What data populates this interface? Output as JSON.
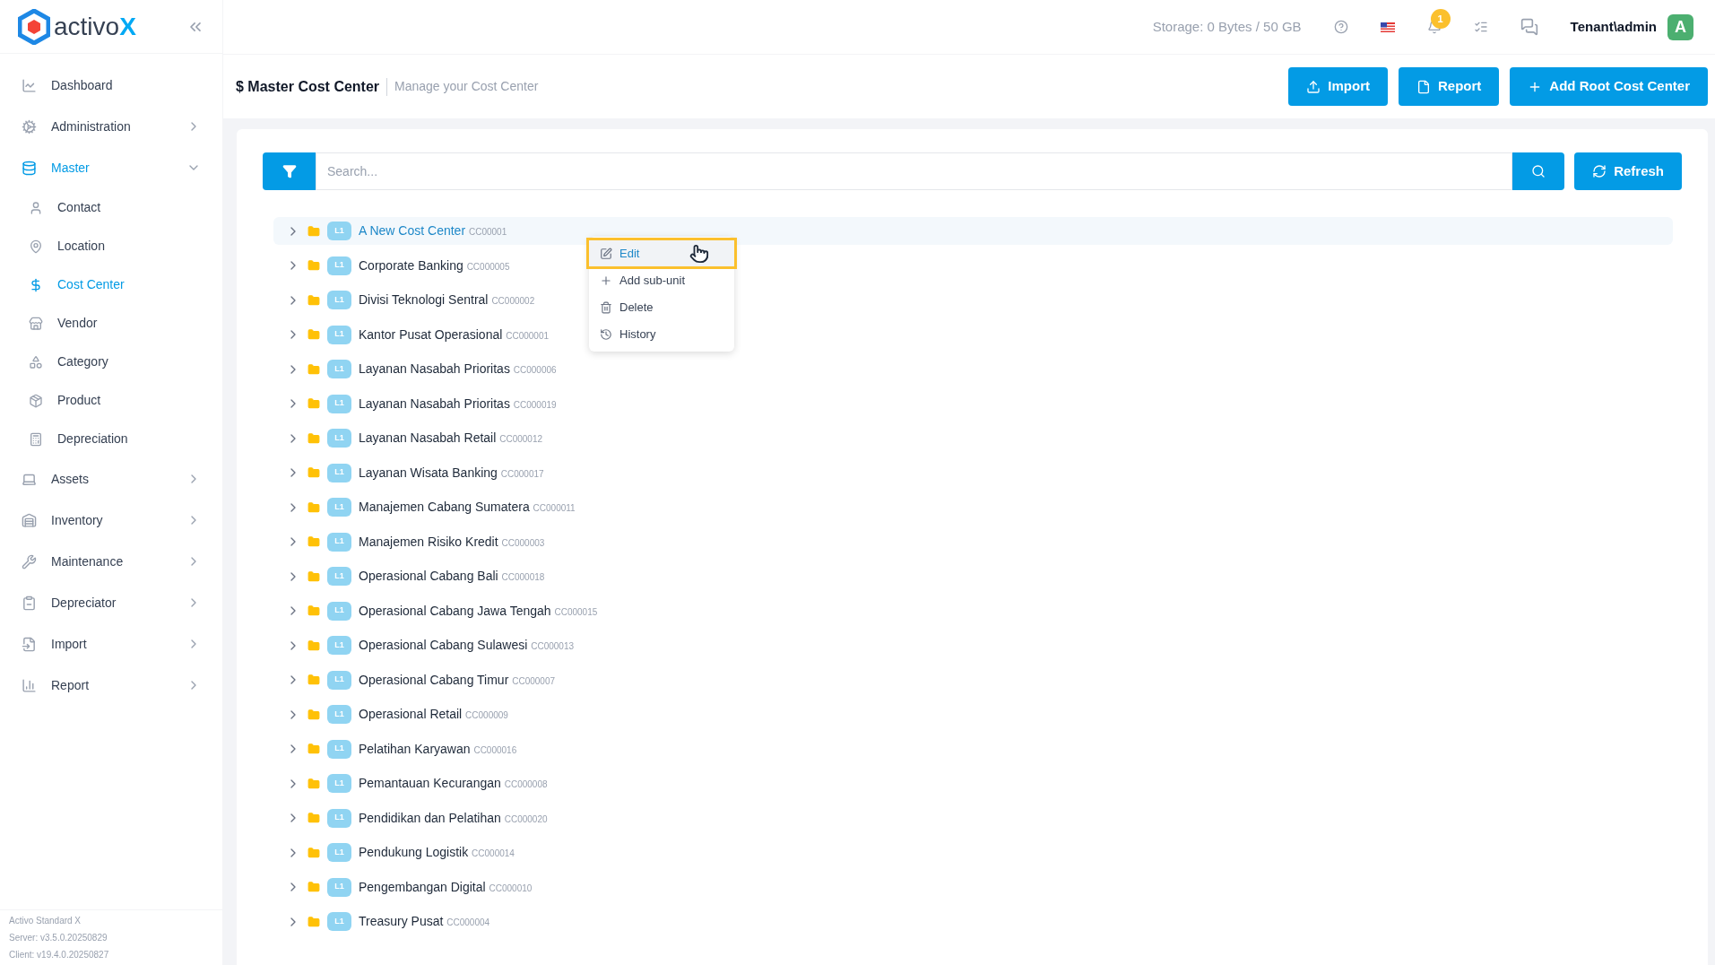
{
  "logo": {
    "text": "activo",
    "accent": "X"
  },
  "sidebar": {
    "items": [
      {
        "label": "Dashboard",
        "kind": "link",
        "selected": false
      },
      {
        "label": "Administration",
        "kind": "group",
        "expanded": false,
        "selected": false
      },
      {
        "label": "Master",
        "kind": "group",
        "expanded": true,
        "selected": true,
        "children": [
          {
            "label": "Contact",
            "selected": false
          },
          {
            "label": "Location",
            "selected": false
          },
          {
            "label": "Cost Center",
            "selected": true
          },
          {
            "label": "Vendor",
            "selected": false
          },
          {
            "label": "Category",
            "selected": false
          },
          {
            "label": "Product",
            "selected": false
          },
          {
            "label": "Depreciation",
            "selected": false
          }
        ]
      },
      {
        "label": "Assets",
        "kind": "group",
        "expanded": false,
        "selected": false
      },
      {
        "label": "Inventory",
        "kind": "group",
        "expanded": false,
        "selected": false
      },
      {
        "label": "Maintenance",
        "kind": "group",
        "expanded": false,
        "selected": false
      },
      {
        "label": "Depreciator",
        "kind": "group",
        "expanded": false,
        "selected": false
      },
      {
        "label": "Import",
        "kind": "group",
        "expanded": false,
        "selected": false
      },
      {
        "label": "Report",
        "kind": "group",
        "expanded": false,
        "selected": false
      }
    ],
    "footer": [
      "Activo Standard X",
      "Server: v3.5.0.20250829",
      "Client: v19.4.0.20250827"
    ]
  },
  "topbar": {
    "storage": "Storage: 0 Bytes / 50 GB",
    "notification_count": "1",
    "user": "Tenant\\admin",
    "avatar": "A"
  },
  "header": {
    "icon": "$",
    "title": "Master Cost Center",
    "subtitle": "Manage your Cost Center",
    "buttons": [
      "Import",
      "Report",
      "Add Root Cost Center"
    ]
  },
  "search": {
    "placeholder": "Search...",
    "refresh": "Refresh"
  },
  "tree": [
    {
      "name": "A New Cost Center",
      "code": "CC00001",
      "level": "L1",
      "selected": true
    },
    {
      "name": "Corporate Banking",
      "code": "CC000005",
      "level": "L1",
      "selected": false
    },
    {
      "name": "Divisi Teknologi Sentral",
      "code": "CC000002",
      "level": "L1",
      "selected": false
    },
    {
      "name": "Kantor Pusat Operasional",
      "code": "CC000001",
      "level": "L1",
      "selected": false
    },
    {
      "name": "Layanan Nasabah Prioritas",
      "code": "CC000006",
      "level": "L1",
      "selected": false
    },
    {
      "name": "Layanan Nasabah Prioritas",
      "code": "CC000019",
      "level": "L1",
      "selected": false
    },
    {
      "name": "Layanan Nasabah Retail",
      "code": "CC000012",
      "level": "L1",
      "selected": false
    },
    {
      "name": "Layanan Wisata Banking",
      "code": "CC000017",
      "level": "L1",
      "selected": false
    },
    {
      "name": "Manajemen Cabang Sumatera",
      "code": "CC000011",
      "level": "L1",
      "selected": false
    },
    {
      "name": "Manajemen Risiko Kredit",
      "code": "CC000003",
      "level": "L1",
      "selected": false
    },
    {
      "name": "Operasional Cabang Bali",
      "code": "CC000018",
      "level": "L1",
      "selected": false
    },
    {
      "name": "Operasional Cabang Jawa Tengah",
      "code": "CC000015",
      "level": "L1",
      "selected": false
    },
    {
      "name": "Operasional Cabang Sulawesi",
      "code": "CC000013",
      "level": "L1",
      "selected": false
    },
    {
      "name": "Operasional Cabang Timur",
      "code": "CC000007",
      "level": "L1",
      "selected": false
    },
    {
      "name": "Operasional Retail",
      "code": "CC000009",
      "level": "L1",
      "selected": false
    },
    {
      "name": "Pelatihan Karyawan",
      "code": "CC000016",
      "level": "L1",
      "selected": false
    },
    {
      "name": "Pemantauan Kecurangan",
      "code": "CC000008",
      "level": "L1",
      "selected": false
    },
    {
      "name": "Pendidikan dan Pelatihan",
      "code": "CC000020",
      "level": "L1",
      "selected": false
    },
    {
      "name": "Pendukung Logistik",
      "code": "CC000014",
      "level": "L1",
      "selected": false
    },
    {
      "name": "Pengembangan Digital",
      "code": "CC000010",
      "level": "L1",
      "selected": false
    },
    {
      "name": "Treasury Pusat",
      "code": "CC000004",
      "level": "L1",
      "selected": false
    }
  ],
  "context_menu": [
    {
      "label": "Edit",
      "selected": true
    },
    {
      "label": "Add sub-unit",
      "selected": false
    },
    {
      "label": "Delete",
      "selected": false
    },
    {
      "label": "History",
      "selected": false
    }
  ]
}
